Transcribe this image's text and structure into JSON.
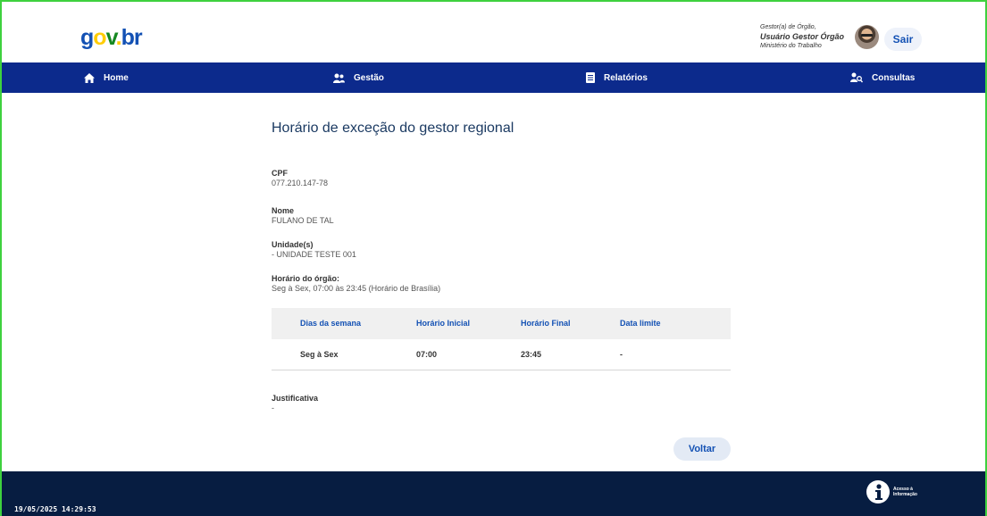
{
  "header": {
    "logo": {
      "g": "g",
      "o": "o",
      "v": "v",
      "dot": ".",
      "br": "br"
    },
    "user_role": "Gestor(a) de Órgão,",
    "user_name": "Usuário Gestor Órgão",
    "user_org": "Ministério do Trabalho",
    "logout_label": "Sair"
  },
  "nav": {
    "items": [
      {
        "label": "Home",
        "icon": "home-icon"
      },
      {
        "label": "Gestão",
        "icon": "users-icon"
      },
      {
        "label": "Relatórios",
        "icon": "document-icon"
      },
      {
        "label": "Consultas",
        "icon": "search-user-icon"
      }
    ]
  },
  "main": {
    "title": "Horário de exceção do gestor regional",
    "cpf_label": "CPF",
    "cpf_value": "077.210.147-78",
    "nome_label": "Nome",
    "nome_value": "FULANO DE TAL",
    "unidade_label": "Unidade(s)",
    "unidade_value": "- UNIDADE TESTE 001",
    "horario_label": "Horário do órgão:",
    "horario_value": "Seg à Sex, 07:00 às 23:45 (Horário de Brasília)",
    "table": {
      "headers": [
        "Dias da semana",
        "Horário Inicial",
        "Horário Final",
        "Data limite"
      ],
      "rows": [
        [
          "Seg à Sex",
          "07:00",
          "23:45",
          "-"
        ]
      ]
    },
    "justificativa_label": "Justificativa",
    "justificativa_value": "-",
    "back_label": "Voltar"
  },
  "footer": {
    "timestamp": "19/05/2025 14:29:53",
    "acesso_line1": "Acesso à",
    "acesso_line2": "Informação"
  },
  "colors": {
    "nav_bg": "#0c2a8c",
    "footer_bg": "#071d41",
    "link_blue": "#1351b4",
    "frame_green": "#3ed13e"
  }
}
